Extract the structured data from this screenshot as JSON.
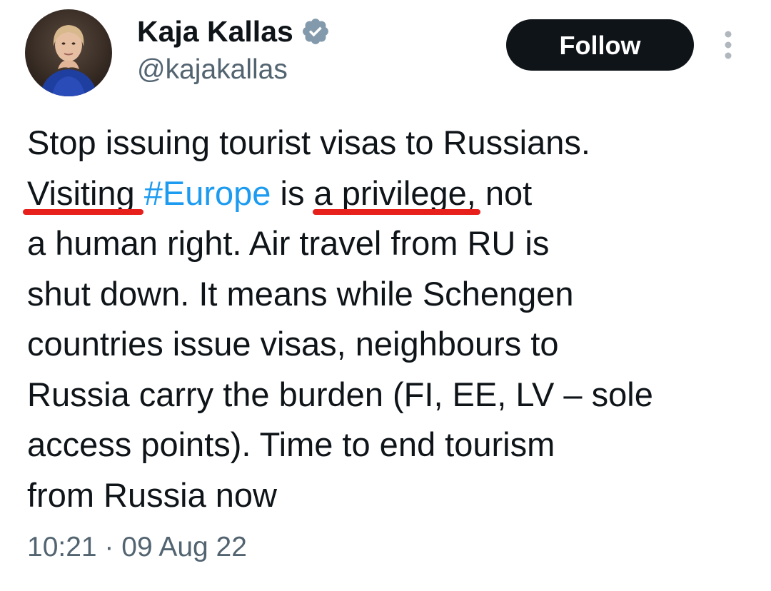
{
  "author": {
    "display_name": "Kaja Kallas",
    "handle": "@kajakallas",
    "avatar_icon": "avatar-photo",
    "verified_icon": "verified-badge-icon"
  },
  "actions": {
    "follow_label": "Follow",
    "more_icon": "more-vertical-icon"
  },
  "tweet": {
    "lines": [
      {
        "text": "Stop issuing tourist visas to Russians."
      },
      {
        "segments": [
          {
            "text": "Visiting",
            "kind": "text"
          },
          {
            "text": " ",
            "kind": "text"
          },
          {
            "text": "#Europe",
            "kind": "hashtag"
          },
          {
            "text": " is ",
            "kind": "text"
          },
          {
            "text": "a privilege,",
            "kind": "text"
          },
          {
            "text": " not",
            "kind": "text"
          }
        ]
      },
      {
        "text": "a human right. Air travel from RU is"
      },
      {
        "text": "shut down. It means while Schengen"
      },
      {
        "text": "countries issue visas, neighbours to"
      },
      {
        "text": "Russia carry the burden (FI, EE, LV – sole"
      },
      {
        "text": "access points). Time to end tourism"
      },
      {
        "text": "from Russia now"
      }
    ],
    "hashtag_color": "#1d9bf0",
    "annotation_color": "#e8201c",
    "timestamp": "10:21 · 09 Aug 22"
  }
}
